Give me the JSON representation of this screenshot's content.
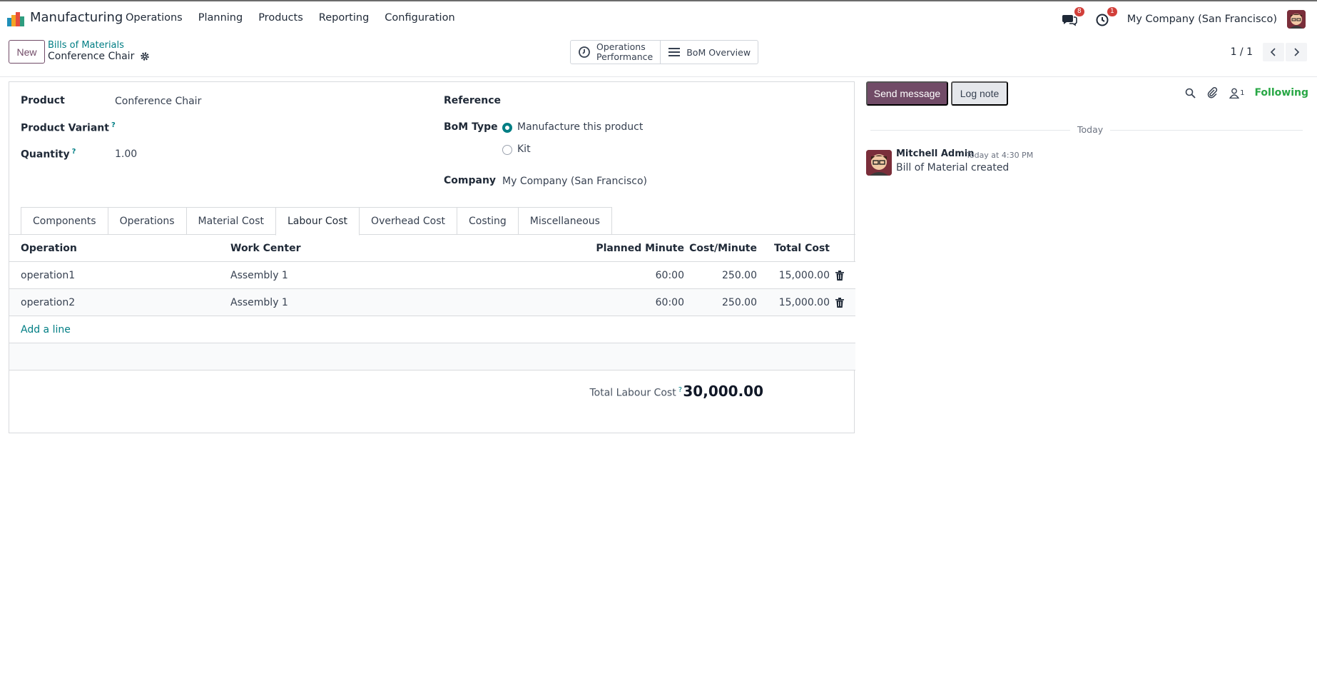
{
  "app": {
    "name": "Manufacturing",
    "menu": [
      "Operations",
      "Planning",
      "Products",
      "Reporting",
      "Configuration"
    ]
  },
  "systray": {
    "messages_badge": "8",
    "activities_badge": "1",
    "company": "My Company (San Francisco)"
  },
  "control": {
    "new_label": "New",
    "breadcrumb_parent": "Bills of Materials",
    "breadcrumb_current": "Conference Chair",
    "smart_ops_line1": "Operations",
    "smart_ops_line2": "Performance",
    "smart_bom": "BoM Overview",
    "pager": "1 / 1"
  },
  "form": {
    "product_label": "Product",
    "product_value": "Conference Chair",
    "variant_label": "Product Variant",
    "quantity_label": "Quantity",
    "quantity_value": "1.00",
    "reference_label": "Reference",
    "bom_type_label": "BoM Type",
    "bom_type_options": [
      "Manufacture this product",
      "Kit"
    ],
    "company_label": "Company",
    "company_value": "My Company (San Francisco)",
    "help_mark": "?"
  },
  "tabs": [
    "Components",
    "Operations",
    "Material Cost",
    "Labour Cost",
    "Overhead Cost",
    "Costing",
    "Miscellaneous"
  ],
  "labour_table": {
    "headers": {
      "operation": "Operation",
      "work_center": "Work Center",
      "planned_minute": "Planned Minute",
      "cost_minute": "Cost/Minute",
      "total_cost": "Total Cost"
    },
    "rows": [
      {
        "operation": "operation1",
        "work_center": "Assembly 1",
        "planned_minute": "60:00",
        "cost_minute": "250.00",
        "total_cost": "15,000.00"
      },
      {
        "operation": "operation2",
        "work_center": "Assembly 1",
        "planned_minute": "60:00",
        "cost_minute": "250.00",
        "total_cost": "15,000.00"
      }
    ],
    "add_line": "Add a line",
    "total_label": "Total Labour Cost",
    "total_value": "30,000.00"
  },
  "chatter": {
    "send_message": "Send message",
    "log_note": "Log note",
    "followers_count": "1",
    "following": "Following",
    "day": "Today",
    "author": "Mitchell Admin",
    "time": "Today at 4:30 PM",
    "body": "Bill of Material created"
  },
  "colors": {
    "brand": "#714b67",
    "link": "#017e84",
    "following": "#28a745",
    "badge": "#d23f3a"
  }
}
